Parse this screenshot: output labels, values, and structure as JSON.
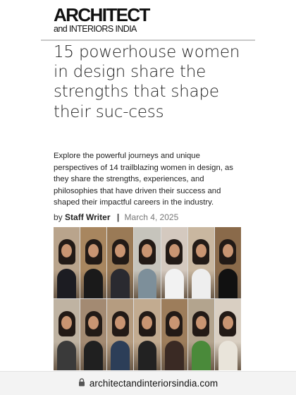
{
  "brand": {
    "line1": "ARCHITECT",
    "line2": "and INTERIORS INDIA"
  },
  "article": {
    "headline": "15 powerhouse women in design share the strengths that shape their suc-cess",
    "dek": "Explore the powerful journeys and unique perspectives of 14 trailblazing women in design, as they share the strengths, experiences, and philosophies that have driven their success and shaped their impactful careers in the industry.",
    "byline": {
      "prefix": "by",
      "author": "Staff Writer",
      "separator": "|",
      "date": "March 4, 2025"
    }
  },
  "collage": {
    "tiles": [
      {
        "bg": "#b9a48c",
        "top": "#1c1c22"
      },
      {
        "bg": "#a8865f",
        "top": "#1a1a1a"
      },
      {
        "bg": "#9a7a56",
        "top": "#2a2a30"
      },
      {
        "bg": "#c6c4bc",
        "top": "#7d8f9a"
      },
      {
        "bg": "#d4c9bf",
        "top": "#f2f2f2"
      },
      {
        "bg": "#c9b7a0",
        "top": "#eeeeee"
      },
      {
        "bg": "#8a6a4a",
        "top": "#111111"
      },
      {
        "bg": "#bfb3a2",
        "top": "#3a3a3a"
      },
      {
        "bg": "#a38a72",
        "top": "#202020"
      },
      {
        "bg": "#b59c80",
        "top": "#2c3e58"
      },
      {
        "bg": "#c2ab90",
        "top": "#222222"
      },
      {
        "bg": "#9d7d5b",
        "top": "#3a2a24"
      },
      {
        "bg": "#b3a48e",
        "top": "#4a8a3a"
      },
      {
        "bg": "#d9cfc2",
        "top": "#e9e4da"
      }
    ]
  },
  "browser": {
    "url": "architectandinteriorsindia.com",
    "lock_icon": "lock-icon"
  }
}
